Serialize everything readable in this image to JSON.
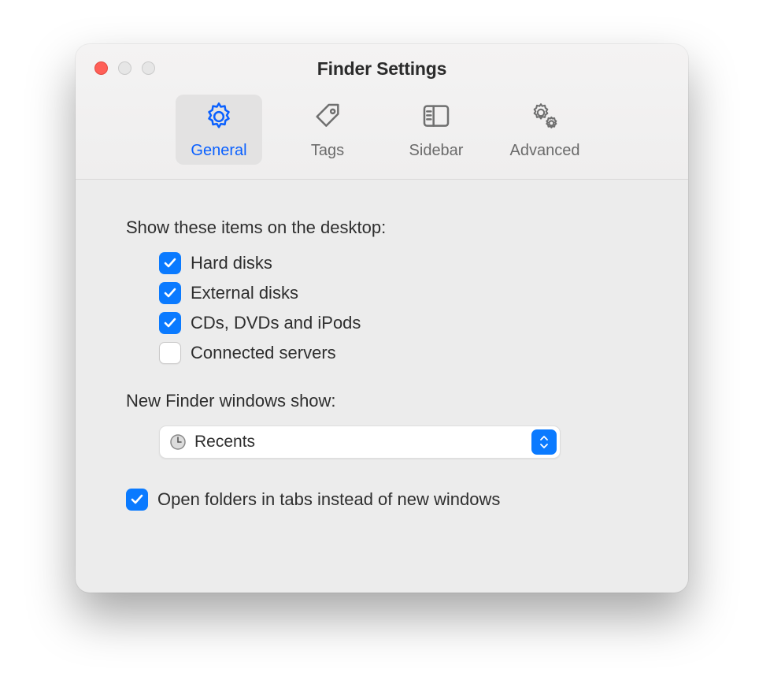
{
  "window": {
    "title": "Finder Settings"
  },
  "tabs": [
    {
      "label": "General",
      "active": true
    },
    {
      "label": "Tags",
      "active": false
    },
    {
      "label": "Sidebar",
      "active": false
    },
    {
      "label": "Advanced",
      "active": false
    }
  ],
  "sections": {
    "desktop_items": {
      "label": "Show these items on the desktop:",
      "options": [
        {
          "label": "Hard disks",
          "checked": true
        },
        {
          "label": "External disks",
          "checked": true
        },
        {
          "label": "CDs, DVDs and iPods",
          "checked": true
        },
        {
          "label": "Connected servers",
          "checked": false
        }
      ]
    },
    "new_windows": {
      "label": "New Finder windows show:",
      "selected": "Recents"
    },
    "open_in_tabs": {
      "label": "Open folders in tabs instead of new windows",
      "checked": true
    }
  }
}
